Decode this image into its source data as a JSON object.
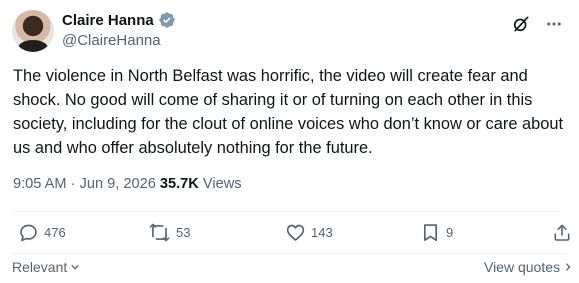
{
  "author": {
    "display_name": "Claire Hanna",
    "handle": "@ClaireHanna"
  },
  "tweet": {
    "text": "The violence in North Belfast was horrific, the video will create fear and shock. No good will come of sharing it or of turning on each other in this society, including for the clout of online voices who don’t know or care about us and who offer absolutely nothing for the future."
  },
  "meta": {
    "time": "9:05 AM",
    "separator": "·",
    "date": "Jun 9, 2026",
    "views_count": "35.7K",
    "views_label": "Views"
  },
  "actions": {
    "replies": "476",
    "reposts": "53",
    "likes": "143",
    "bookmarks": "9"
  },
  "footer": {
    "sort_label": "Relevant",
    "view_quotes_label": "View quotes"
  },
  "icons": {
    "verified": "verified-badge-icon",
    "grok": "grok-icon",
    "more": "more-horizontal-icon",
    "reply": "reply-icon",
    "repost": "repost-icon",
    "like": "heart-icon",
    "bookmark": "bookmark-icon",
    "share": "share-icon"
  },
  "colors": {
    "verified": "#829aab",
    "text": "#0f1419",
    "secondary": "#536471"
  }
}
